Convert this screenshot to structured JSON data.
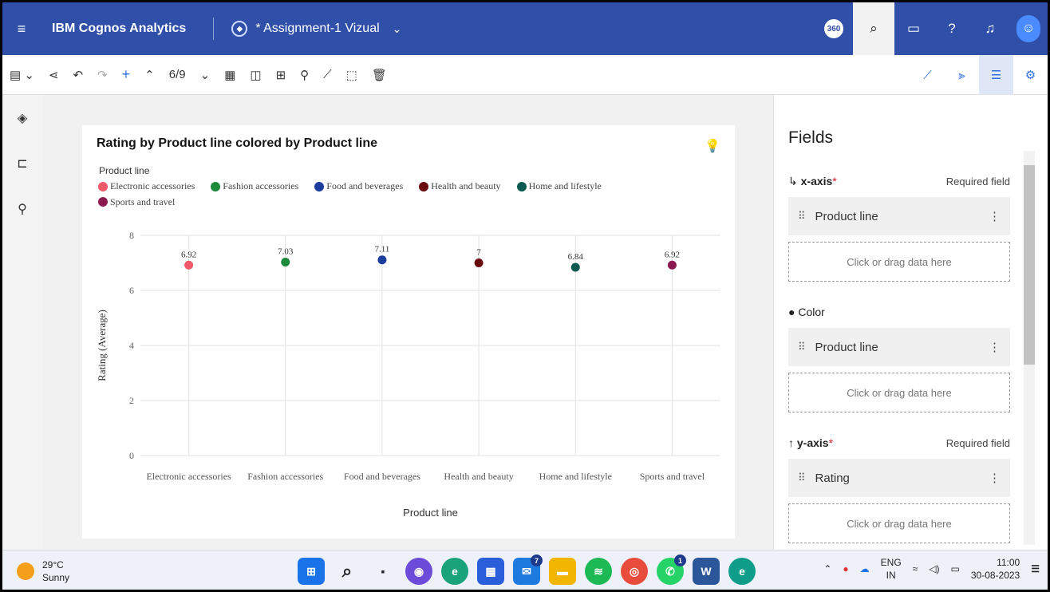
{
  "app": {
    "brand": "IBM Cognos Analytics",
    "document_title": "* Assignment-1 Vizual",
    "badge": "360"
  },
  "toolbar": {
    "page_indicator": "6/9"
  },
  "chart_data": {
    "type": "scatter",
    "title": "Rating by Product line colored by Product line",
    "xlabel": "Product line",
    "ylabel": "Rating (Average)",
    "legend_title": "Product line",
    "legend_position": "top-left",
    "grid": true,
    "ylim": [
      0,
      8
    ],
    "yticks": [
      0,
      2,
      4,
      6,
      8
    ],
    "categories": [
      "Electronic accessories",
      "Fashion accessories",
      "Food and beverages",
      "Health and beauty",
      "Home and lifestyle",
      "Sports and travel"
    ],
    "values": [
      6.92,
      7.03,
      7.11,
      7,
      6.84,
      6.92
    ],
    "data_labels": [
      "6.92",
      "7.03",
      "7.11",
      "7",
      "6.84",
      "6.92"
    ],
    "colors": [
      "#ee5a6a",
      "#1e8a3c",
      "#1a3d9e",
      "#6a0a0f",
      "#0b5a52",
      "#8a1a50"
    ]
  },
  "panel": {
    "title": "Fields",
    "required_label": "Required field",
    "drop_placeholder": "Click or drag data here",
    "x_axis": {
      "label": "x-axis",
      "star": "*",
      "field": "Product line"
    },
    "color": {
      "label": "Color",
      "field": "Product line"
    },
    "y_axis": {
      "label": "y-axis",
      "star": "*",
      "field": "Rating"
    }
  },
  "taskbar": {
    "temperature": "29°C",
    "condition": "Sunny",
    "lang1": "ENG",
    "lang2": "IN",
    "time": "11:00",
    "date": "30-08-2023",
    "badge_mail": "7",
    "badge_whatsapp": "1"
  }
}
